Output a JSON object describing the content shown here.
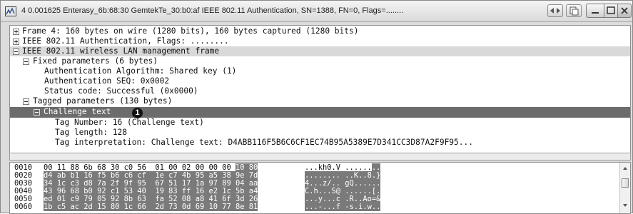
{
  "window": {
    "title": "4 0.001625 Enterasy_6b:68:30 GemtekTe_30:b0:af IEEE 802.11  Authentication, SN=1388, FN=0, Flags=........"
  },
  "tree": {
    "frame": "Frame 4: 160 bytes on wire (1280 bits), 160 bytes captured (1280 bits)",
    "auth_header": "IEEE 802.11 Authentication, Flags: ........",
    "mgmt_frame": "IEEE 802.11 wireless LAN management frame",
    "fixed_params": "Fixed parameters (6 bytes)",
    "auth_alg": "Authentication Algorithm: Shared key (1)",
    "auth_seq": "Authentication SEQ: 0x0002",
    "status_code": "Status code: Successful (0x0000)",
    "tagged_params": "Tagged parameters (130 bytes)",
    "challenge_text": "Challenge text",
    "tag_number": "Tag Number: 16 (Challenge text)",
    "tag_length": "Tag length: 128",
    "tag_interp": "Tag interpretation: Challenge text: D4ABB116F5B6C6CF1EC74B95A5389E7D341CC3D87A2F9F95..."
  },
  "callout": {
    "marker": "1"
  },
  "hex": {
    "rows": [
      {
        "offset": "0010",
        "plain": "00 11 88 6b 68 30 c0 56  01 00 02 00 00 00 ",
        "hi": "10 80",
        "ascii_plain": "...kh0.V ......",
        "ascii_hi": ".."
      },
      {
        "offset": "0020",
        "plain": "",
        "hi": "d4 ab b1 16 f5 b6 c6 cf  1e c7 4b 95 a5 38 9e 7d",
        "ascii_plain": "",
        "ascii_hi": "........ ..K..8.}"
      },
      {
        "offset": "0030",
        "plain": "",
        "hi": "34 1c c3 d8 7a 2f 9f 95  67 51 17 1a 97 89 04 aa",
        "ascii_plain": "",
        "ascii_hi": "4...z/.. gQ......"
      },
      {
        "offset": "0040",
        "plain": "",
        "hi": "43 96 68 b0 92 c1 53 40  19 83 ff 16 e2 1c 5b a4",
        "ascii_plain": "",
        "ascii_hi": "C.h...S@ ......[."
      },
      {
        "offset": "0050",
        "plain": "",
        "hi": "ed 01 c9 79 05 92 8b 63  fa 52 08 a8 41 6f 3d 26",
        "ascii_plain": "",
        "ascii_hi": "...y...c .R..Ao=&"
      },
      {
        "offset": "0060",
        "plain": "",
        "hi": "1b c5 ac 2d 15 80 1c 66  2d 73 0d 69 10 77 8e 81",
        "ascii_plain": "",
        "ascii_hi": "...-...f -s.i.w.."
      }
    ]
  }
}
